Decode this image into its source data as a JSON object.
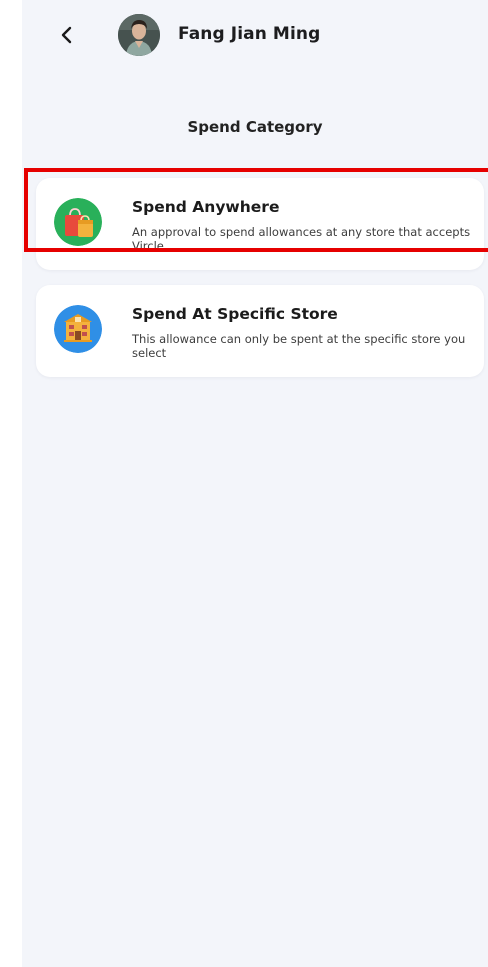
{
  "header": {
    "user_name": "Fang Jian Ming",
    "back_icon": "chevron-left-icon",
    "avatar": "user-avatar"
  },
  "page": {
    "title": "Spend Category"
  },
  "categories": [
    {
      "title": "Spend Anywhere",
      "description": "An approval to spend allowances at any store that accepts Vircle",
      "icon": "shopping-bags-icon",
      "icon_bg": "#29b05a",
      "selected": true
    },
    {
      "title": "Spend At Specific Store",
      "description": "This allowance can only be spent at the specific store you select",
      "icon": "store-building-icon",
      "icon_bg": "#2f8fe6",
      "selected": false
    }
  ],
  "colors": {
    "background": "#f3f5fa",
    "card": "#ffffff",
    "highlight": "#e60000"
  }
}
